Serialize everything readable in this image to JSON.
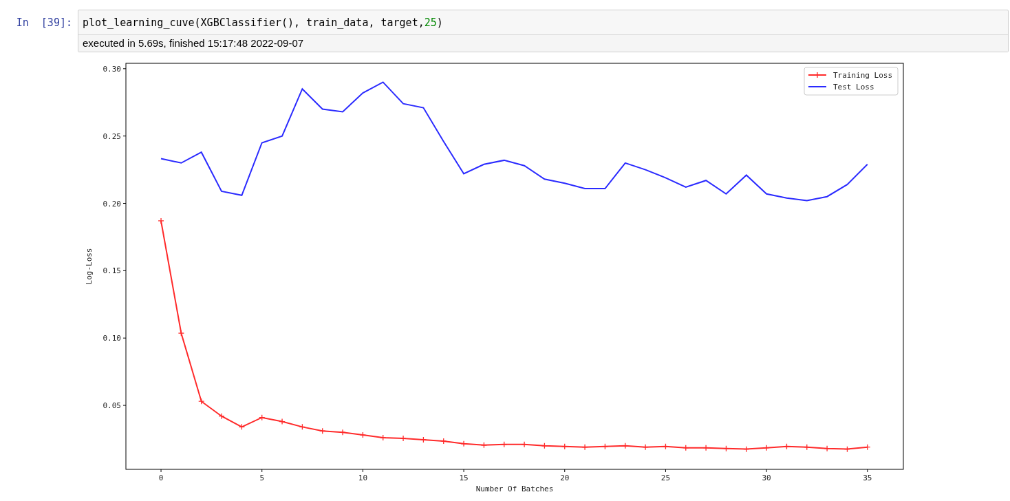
{
  "cell": {
    "prompt": "In  [39]:",
    "code": [
      {
        "text": "plot_learning_cuve(XGBClassifier(), train_data, target,",
        "kind": "plain"
      },
      {
        "text": "25",
        "kind": "number"
      },
      {
        "text": ")",
        "kind": "plain"
      }
    ],
    "execution_info": "executed in 5.69s, finished 15:17:48 2022-09-07"
  },
  "output": {
    "chart_data": {
      "type": "line",
      "xlabel": "Number Of Batches",
      "ylabel": "Log-Loss",
      "x": [
        0,
        1,
        2,
        3,
        4,
        5,
        6,
        7,
        8,
        9,
        10,
        11,
        12,
        13,
        14,
        15,
        16,
        17,
        18,
        19,
        20,
        21,
        22,
        23,
        24,
        25,
        26,
        27,
        28,
        29,
        30,
        31,
        32,
        33,
        34,
        35
      ],
      "series": [
        {
          "name": "Training Loss",
          "color": "#ff2a2a",
          "marker": "+",
          "values": [
            0.187,
            0.1036,
            0.053,
            0.042,
            0.034,
            0.041,
            0.038,
            0.034,
            0.031,
            0.03,
            0.028,
            0.026,
            0.0255,
            0.0245,
            0.0235,
            0.0215,
            0.0205,
            0.021,
            0.021,
            0.02,
            0.0195,
            0.019,
            0.0195,
            0.02,
            0.019,
            0.0195,
            0.0185,
            0.0185,
            0.018,
            0.0175,
            0.0185,
            0.0195,
            0.019,
            0.018,
            0.0175,
            0.019
          ]
        },
        {
          "name": "Test Loss",
          "color": "#2a2aff",
          "values": [
            0.2332,
            0.23,
            0.238,
            0.209,
            0.206,
            0.245,
            0.25,
            0.285,
            0.27,
            0.268,
            0.282,
            0.29,
            0.274,
            0.271,
            0.246,
            0.222,
            0.229,
            0.232,
            0.228,
            0.218,
            0.215,
            0.211,
            0.211,
            0.23,
            0.225,
            0.219,
            0.212,
            0.217,
            0.207,
            0.221,
            0.207,
            0.204,
            0.202,
            0.205,
            0.214,
            0.229
          ]
        }
      ],
      "legend": true,
      "xlim": [
        -1.74,
        36.78
      ],
      "ylim": [
        0.0025,
        0.304
      ],
      "xticks": [
        0,
        5,
        10,
        15,
        20,
        25,
        30,
        35
      ],
      "yticks": [
        {
          "value": 0.05,
          "label": "0.05"
        },
        {
          "value": 0.1,
          "label": "0.10"
        },
        {
          "value": 0.15,
          "label": "0.15"
        },
        {
          "value": 0.2,
          "label": "0.20"
        },
        {
          "value": 0.25,
          "label": "0.25"
        },
        {
          "value": 0.3,
          "label": "0.30"
        }
      ]
    }
  }
}
